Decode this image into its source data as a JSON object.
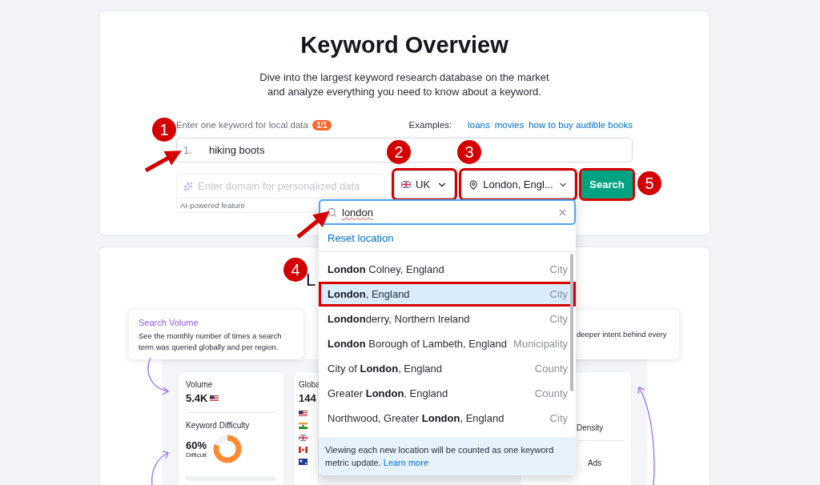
{
  "header": {
    "title": "Keyword Overview",
    "subtitle": [
      "Dive into the largest keyword research database on the market",
      "and analyze everything you need to know about a keyword."
    ]
  },
  "keyword_form": {
    "label": "Enter one keyword for local data",
    "counter": "1/1",
    "examples_label": "Examples:",
    "examples": [
      "loans",
      "movies",
      "how to buy audible books"
    ],
    "keyword_input": {
      "index": "1.",
      "value": "hiking boots"
    },
    "domain_input": {
      "placeholder": "Enter domain for personalized data",
      "note": "AI-powered feature"
    },
    "database_select": {
      "value": "UK",
      "highlighted": true
    },
    "location_select": {
      "value": "London, Engl...",
      "highlighted": true
    },
    "search_button": {
      "label": "Search",
      "highlighted": true
    }
  },
  "location_dropdown": {
    "search": {
      "value": "london",
      "misspelled": true
    },
    "reset_link": "Reset location",
    "options": [
      {
        "name": "**London** Colney, England",
        "type": "City",
        "selected": false,
        "highlighted": false
      },
      {
        "name": "**London**, England",
        "type": "City",
        "selected": true,
        "highlighted": true
      },
      {
        "name": "**London**derry, Northern Ireland",
        "type": "City",
        "selected": false,
        "highlighted": false
      },
      {
        "name": "**London** Borough of Lambeth, England",
        "type": "Municipality",
        "selected": false,
        "highlighted": false
      },
      {
        "name": "City of **London**, England",
        "type": "County",
        "selected": false,
        "highlighted": false
      },
      {
        "name": "Greater **London**, England",
        "type": "County",
        "selected": false,
        "highlighted": false
      },
      {
        "name": "Northwood, Greater **London**, England",
        "type": "City",
        "selected": false,
        "highlighted": false
      }
    ],
    "notice": {
      "text": "Viewing each new location will be counted as one keyword metric update.",
      "link": "Learn more"
    }
  },
  "feature_preview": {
    "heading": "L",
    "tooltips": [
      {
        "title": "Search Volume",
        "text": "See the monthly number of times a search term was queried globally and per region."
      },
      {
        "text": "deeper intent behind every"
      }
    ],
    "volume_card": {
      "label": "Volume",
      "value": "5.4K",
      "difficulty_label": "Keyword Difficulty",
      "difficulty_value": "60%",
      "difficulty_rating": "Difficult"
    },
    "global_card": {
      "label": "Globa",
      "value": "144"
    },
    "right_card": {
      "label": "Density",
      "ads_label": "Ads"
    }
  },
  "annotations": [
    {
      "number": "1",
      "arrow": true
    },
    {
      "number": "2"
    },
    {
      "number": "3"
    },
    {
      "number": "4",
      "arrow": true
    },
    {
      "number": "5"
    }
  ]
}
